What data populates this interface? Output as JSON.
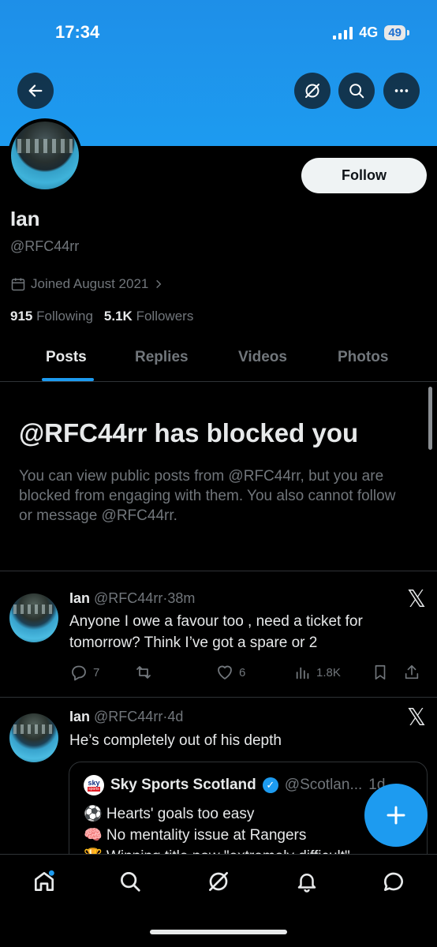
{
  "status_bar": {
    "time": "17:34",
    "network": "4G",
    "battery": "49"
  },
  "header": {
    "back_icon": "arrow-left-icon",
    "grok_icon": "grok-icon",
    "search_icon": "search-icon",
    "more_icon": "more-icon"
  },
  "profile": {
    "name": "Ian",
    "handle": "@RFC44rr",
    "joined": "Joined August 2021",
    "following_count": "915",
    "following_label": "Following",
    "followers_count": "5.1K",
    "followers_label": "Followers",
    "follow_label": "Follow"
  },
  "tabs": [
    {
      "label": "Posts",
      "active": true
    },
    {
      "label": "Replies",
      "active": false
    },
    {
      "label": "Videos",
      "active": false
    },
    {
      "label": "Photos",
      "active": false
    }
  ],
  "blocked": {
    "title": "@RFC44rr has blocked you",
    "text": "You can view public posts from @RFC44rr, but you are blocked from engaging with them. You also cannot follow or message @RFC44rr."
  },
  "posts": [
    {
      "name": "Ian",
      "handle": "@RFC44rr",
      "separator": "·",
      "time": "38m",
      "text": "Anyone I owe a favour too , need a ticket for tomorrow? Think I’ve got a spare or 2",
      "replies": "7",
      "reposts": "",
      "likes": "6",
      "views": "1.8K"
    },
    {
      "name": "Ian",
      "handle": "@RFC44rr",
      "separator": "·",
      "time": "4d",
      "text": "He’s completely out of his depth",
      "quote": {
        "logo_top": "sky",
        "logo_bottom": "sports",
        "name": "Sky Sports Scotland",
        "handle": "@Scotlan...",
        "time": "1d",
        "lines": [
          "⚽ Hearts' goals too easy",
          "🧠 No mentality issue at Rangers",
          "🏆 Winning title now \"extremely difficult\""
        ]
      }
    }
  ],
  "bottom_nav": [
    "home-icon",
    "search-icon",
    "grok-icon",
    "notifications-icon",
    "messages-icon"
  ],
  "colors": {
    "accent": "#1d9bf0",
    "background": "#000000",
    "muted": "#71767b",
    "text": "#e7e9ea"
  }
}
